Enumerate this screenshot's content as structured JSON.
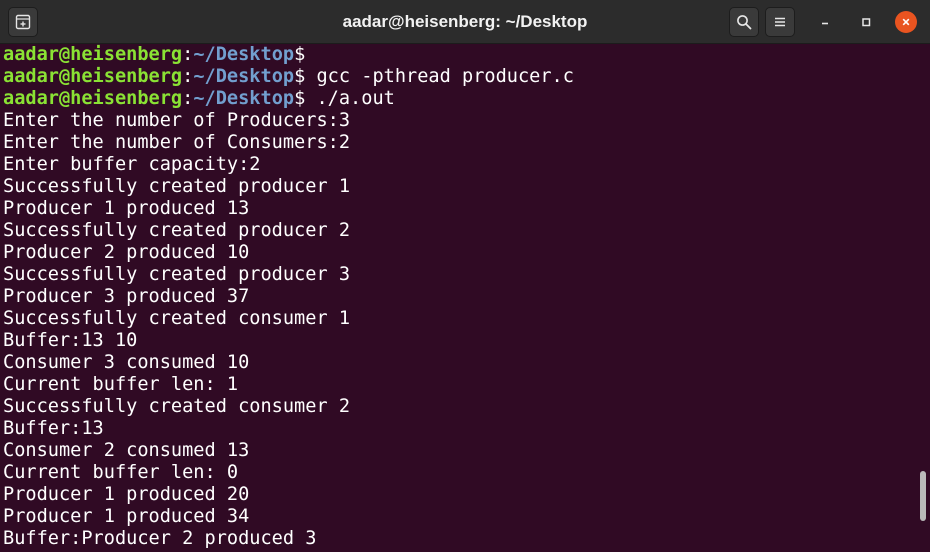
{
  "window": {
    "title": "aadar@heisenberg: ~/Desktop"
  },
  "titlebar": {
    "icons": {
      "new_tab": "new-tab-icon",
      "search": "search-icon",
      "menu": "hamburger-menu-icon",
      "minimize": "minimize-icon",
      "maximize": "maximize-icon",
      "close": "close-icon"
    }
  },
  "colors": {
    "background": "#300a24",
    "prompt_user": "#8ae234",
    "prompt_path": "#729fcf",
    "text": "#ffffff",
    "close_button": "#e95420"
  },
  "prompt": {
    "user_host": "aadar@heisenberg",
    "colon": ":",
    "path": "~/Desktop",
    "symbol": "$"
  },
  "terminal": {
    "commands": [
      "",
      " gcc -pthread producer.c",
      " ./a.out"
    ],
    "output": [
      "Enter the number of Producers:3",
      "Enter the number of Consumers:2",
      "Enter buffer capacity:2",
      "Successfully created producer 1",
      "Producer 1 produced 13",
      "Successfully created producer 2",
      "Producer 2 produced 10",
      "Successfully created producer 3",
      "Producer 3 produced 37",
      "Successfully created consumer 1",
      "Buffer:13 10",
      "Consumer 3 consumed 10",
      "Current buffer len: 1",
      "Successfully created consumer 2",
      "Buffer:13",
      "Consumer 2 consumed 13",
      "Current buffer len: 0",
      "Producer 1 produced 20",
      "Producer 1 produced 34",
      "Buffer:Producer 2 produced 3"
    ]
  }
}
